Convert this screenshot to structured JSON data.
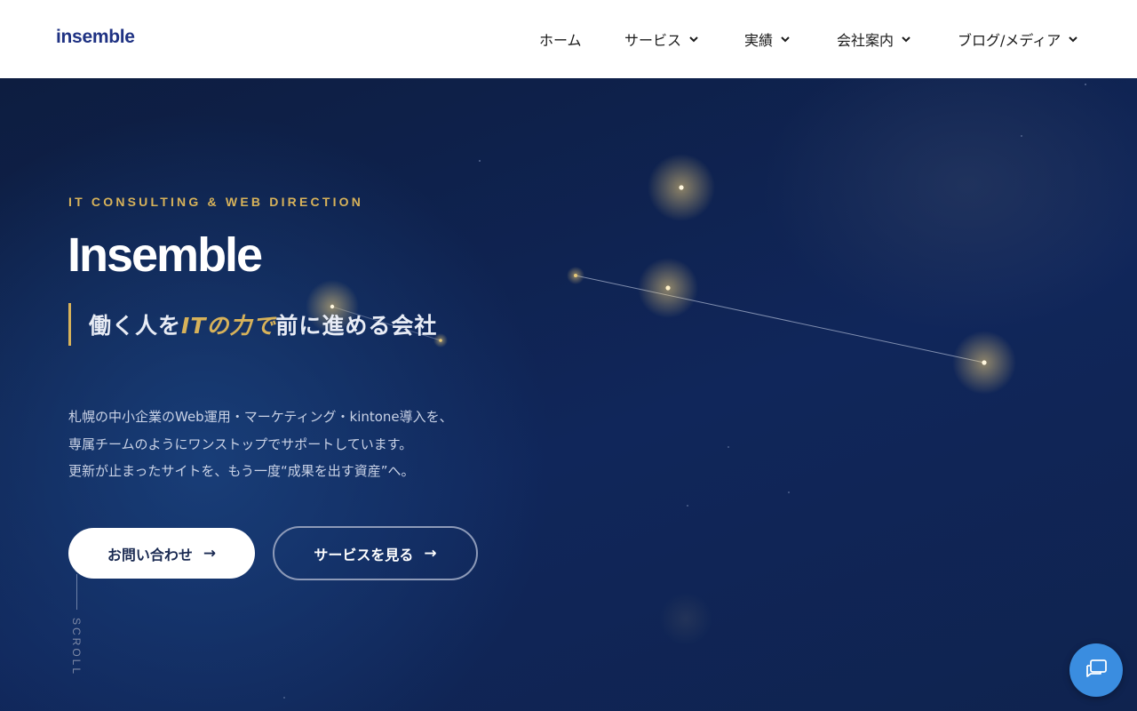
{
  "header": {
    "logo": "insemble",
    "nav": [
      {
        "label": "ホーム",
        "has_dropdown": false
      },
      {
        "label": "サービス",
        "has_dropdown": true
      },
      {
        "label": "実績",
        "has_dropdown": true
      },
      {
        "label": "会社案内",
        "has_dropdown": true
      },
      {
        "label": "ブログ/メディア",
        "has_dropdown": true
      }
    ]
  },
  "hero": {
    "eyebrow": "IT CONSULTING & WEB DIRECTION",
    "title": "Insemble",
    "tagline": {
      "before": "働く人を",
      "accent": "ITの力で",
      "after": "前に進める会社"
    },
    "description": [
      "札幌の中小企業のWeb運用・マーケティング・kintone導入を、",
      "専属チームのようにワンストップでサポートしています。",
      "更新が止まったサイトを、もう一度“成果を出す資産”へ。"
    ],
    "primary_button": {
      "label": "お問い合わせ",
      "arrow": "→"
    },
    "secondary_button": {
      "label": "サービスを見る",
      "arrow": "→"
    },
    "scroll_label": "SCROLL"
  },
  "chat": {
    "icon": "chat-icon"
  },
  "colors": {
    "brand": "#1f3283",
    "accent_gold": "#d7b25a",
    "hero_bg": "#0e1f44",
    "chat_blue": "#3a8de0"
  }
}
